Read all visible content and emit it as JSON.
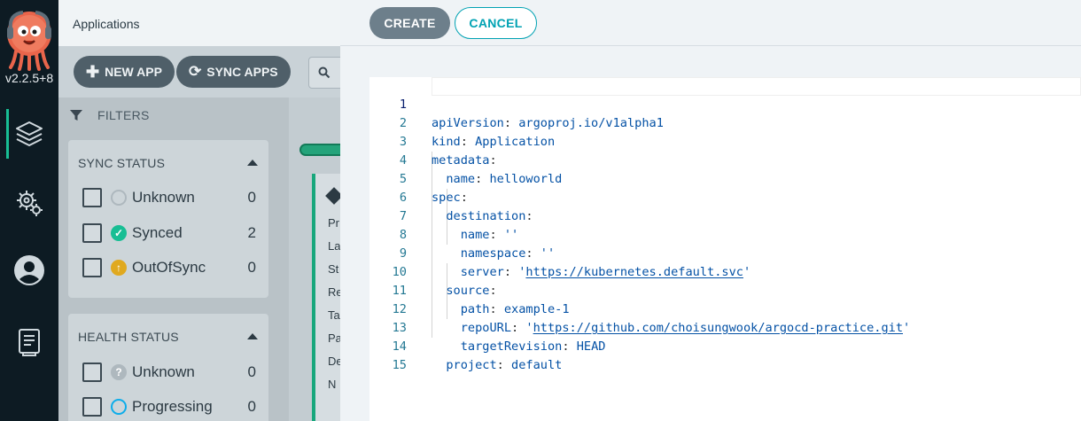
{
  "nav": {
    "version": "v2.2.5+8",
    "items": [
      "applications-icon",
      "settings-icon",
      "user-icon",
      "docs-icon"
    ]
  },
  "background": {
    "page_title": "Applications",
    "new_app_label": "NEW APP",
    "sync_apps_label": "SYNC APPS",
    "filters_label": "FILTERS",
    "sync_status": {
      "title": "SYNC STATUS",
      "rows": [
        {
          "label": "Unknown",
          "count": "0"
        },
        {
          "label": "Synced",
          "count": "2"
        },
        {
          "label": "OutOfSync",
          "count": "0"
        }
      ]
    },
    "health_status": {
      "title": "HEALTH STATUS",
      "rows": [
        {
          "label": "Unknown",
          "count": "0"
        },
        {
          "label": "Progressing",
          "count": "0"
        }
      ]
    },
    "card_labels": [
      "Pr",
      "La",
      "St",
      "Re",
      "Ta",
      "Pa",
      "De",
      "N"
    ]
  },
  "sheet": {
    "create_label": "CREATE",
    "cancel_label": "CANCEL"
  },
  "editor": {
    "line_numbers": [
      "1",
      "2",
      "3",
      "4",
      "5",
      "6",
      "7",
      "8",
      "9",
      "10",
      "11",
      "12",
      "13",
      "14",
      "15"
    ],
    "lines": {
      "l1": {
        "key": "apiVersion",
        "value": "argoproj.io/v1alpha1"
      },
      "l2": {
        "key": "kind",
        "value": "Application"
      },
      "l3": {
        "key": "metadata"
      },
      "l4": {
        "key": "name",
        "value": "helloworld"
      },
      "l5": {
        "key": "spec"
      },
      "l6": {
        "key": "destination"
      },
      "l7": {
        "key": "name",
        "value": "''"
      },
      "l8": {
        "key": "namespace",
        "value": "''"
      },
      "l9": {
        "key": "server",
        "value": "https://kubernetes.default.svc"
      },
      "l10": {
        "key": "source"
      },
      "l11": {
        "key": "path",
        "value": "example-1"
      },
      "l12": {
        "key": "repoURL",
        "value": "https://github.com/choisungwook/argocd-practice.git"
      },
      "l13": {
        "key": "targetRevision",
        "value": "HEAD"
      },
      "l14": {
        "key": "project",
        "value": "default"
      }
    }
  },
  "colors": {
    "accent": "#00a2b3",
    "synced": "#18be94",
    "out_of_sync": "#f4c030",
    "nav_bg": "#0d1b23"
  }
}
